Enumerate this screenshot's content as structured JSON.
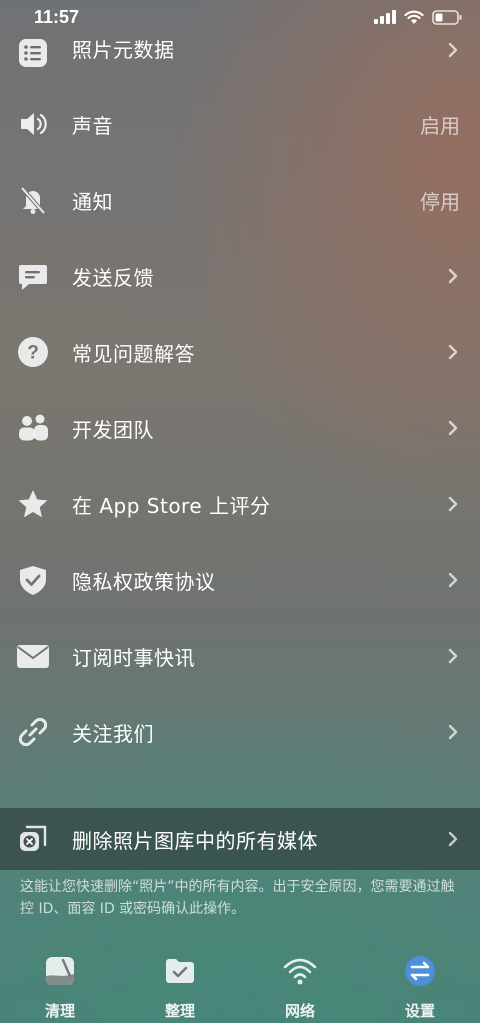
{
  "status_bar": {
    "time": "11:57"
  },
  "menu": {
    "items": [
      {
        "label": "照片元数据",
        "value": "",
        "icon": "list-icon"
      },
      {
        "label": "声音",
        "value": "启用",
        "icon": "speaker-icon"
      },
      {
        "label": "通知",
        "value": "停用",
        "icon": "bell-slash-icon"
      },
      {
        "label": "发送反馈",
        "value": "",
        "icon": "message-icon"
      },
      {
        "label": "常见问题解答",
        "value": "",
        "icon": "question-icon"
      },
      {
        "label": "开发团队",
        "value": "",
        "icon": "people-icon"
      },
      {
        "label": "在 App Store 上评分",
        "value": "",
        "icon": "star-icon"
      },
      {
        "label": "隐私权政策协议",
        "value": "",
        "icon": "shield-check-icon"
      },
      {
        "label": "订阅时事快讯",
        "value": "",
        "icon": "envelope-icon"
      },
      {
        "label": "关注我们",
        "value": "",
        "icon": "link-icon"
      }
    ]
  },
  "danger": {
    "label": "删除照片图库中的所有媒体",
    "icon": "delete-library-icon",
    "footnote": "这能让您快速删除“照片”中的所有内容。出于安全原因，您需要通过触控 ID、面容 ID 或密码确认此操作。"
  },
  "tabbar": {
    "tabs": [
      {
        "label": "清理",
        "icon": "clean-icon"
      },
      {
        "label": "整理",
        "icon": "organize-icon"
      },
      {
        "label": "网络",
        "icon": "network-icon"
      },
      {
        "label": "设置",
        "icon": "settings-icon",
        "active": true
      }
    ]
  }
}
